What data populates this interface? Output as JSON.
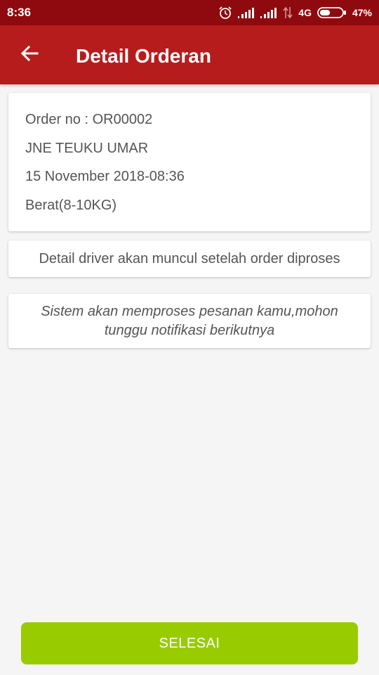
{
  "status_bar": {
    "time": "8:36",
    "network": "4G",
    "battery": "47%",
    "battery_level": 0.47,
    "icons": [
      "alarm-icon",
      "signal-icon",
      "signal-icon",
      "data-transfer-icon",
      "battery-icon"
    ]
  },
  "app_bar": {
    "back_icon": "arrow-left-icon",
    "title": "Detail Orderan",
    "color": "#b71c1c"
  },
  "order": {
    "order_no": "Order no : OR00002",
    "courier": "JNE TEUKU UMAR",
    "datetime": "15 November 2018-08:36",
    "weight": "Berat(8-10KG)"
  },
  "driver_notice": "Detail driver akan muncul setelah order diproses",
  "system_notice": "Sistem akan memproses pesanan kamu,mohon tunggu notifikasi berikutnya",
  "finish_button": {
    "label": "SELESAI",
    "color": "#99cc00"
  }
}
